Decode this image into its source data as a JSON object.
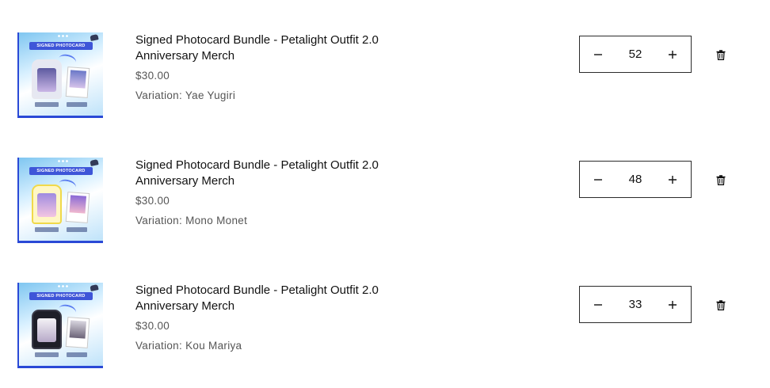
{
  "cart": {
    "items": [
      {
        "title": "Signed Photocard Bundle - Petalight Outfit 2.0 Anniversary Merch",
        "price": "$30.00",
        "variation": "Variation: Yae Yugiri",
        "quantity": "52",
        "image_banner": "SIGNED PHOTOCARD",
        "holder_color": "#cfd3e6",
        "char_color": "#9a86c9"
      },
      {
        "title": "Signed Photocard Bundle - Petalight Outfit 2.0 Anniversary Merch",
        "price": "$30.00",
        "variation": "Variation: Mono Monet",
        "quantity": "48",
        "image_banner": "SIGNED PHOTOCARD",
        "holder_color": "#f3e25a",
        "char_color": "#8b6fd6"
      },
      {
        "title": "Signed Photocard Bundle - Petalight Outfit 2.0 Anniversary Merch",
        "price": "$30.00",
        "variation": "Variation: Kou Mariya",
        "quantity": "33",
        "image_banner": "SIGNED PHOTOCARD",
        "holder_color": "#1c1c24",
        "char_color": "#e8e6ec"
      }
    ],
    "icons": {
      "decrease": "minus-icon",
      "increase": "plus-icon",
      "remove": "trash-icon"
    }
  }
}
